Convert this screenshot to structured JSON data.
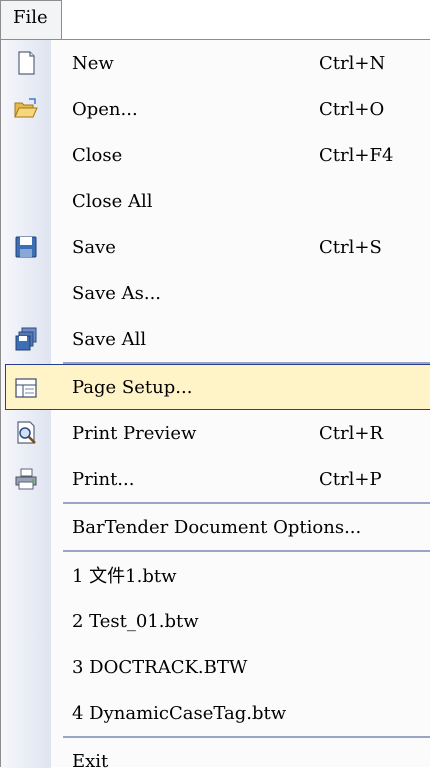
{
  "menubar": {
    "file_label": "File"
  },
  "menu": {
    "items": [
      {
        "id": "new",
        "label": "New",
        "shortcut": "Ctrl+N",
        "icon": "new-document-icon"
      },
      {
        "id": "open",
        "label": "Open...",
        "shortcut": "Ctrl+O",
        "icon": "open-folder-icon"
      },
      {
        "id": "close",
        "label": "Close",
        "shortcut": "Ctrl+F4"
      },
      {
        "id": "close-all",
        "label": "Close All"
      },
      {
        "id": "save",
        "label": "Save",
        "shortcut": "Ctrl+S",
        "icon": "floppy-disk-icon"
      },
      {
        "id": "save-as",
        "label": "Save As..."
      },
      {
        "id": "save-all",
        "label": "Save All",
        "icon": "save-all-icon"
      },
      {
        "id": "page-setup",
        "label": "Page Setup...",
        "icon": "page-setup-icon",
        "highlighted": true
      },
      {
        "id": "print-preview",
        "label": "Print Preview",
        "shortcut": "Ctrl+R",
        "icon": "print-preview-icon"
      },
      {
        "id": "print",
        "label": "Print...",
        "shortcut": "Ctrl+P",
        "icon": "printer-icon"
      },
      {
        "id": "document-options",
        "label": "BarTender Document Options..."
      },
      {
        "id": "recent-1",
        "label": "1 文件1.btw"
      },
      {
        "id": "recent-2",
        "label": "2 Test_01.btw"
      },
      {
        "id": "recent-3",
        "label": "3 DOCTRACK.BTW"
      },
      {
        "id": "recent-4",
        "label": "4 DynamicCaseTag.btw"
      },
      {
        "id": "exit",
        "label": "Exit"
      }
    ]
  },
  "colors": {
    "highlight_bg": "#fff3c8",
    "highlight_border": "#2b3e8c",
    "separator": "#9aa6c8"
  }
}
